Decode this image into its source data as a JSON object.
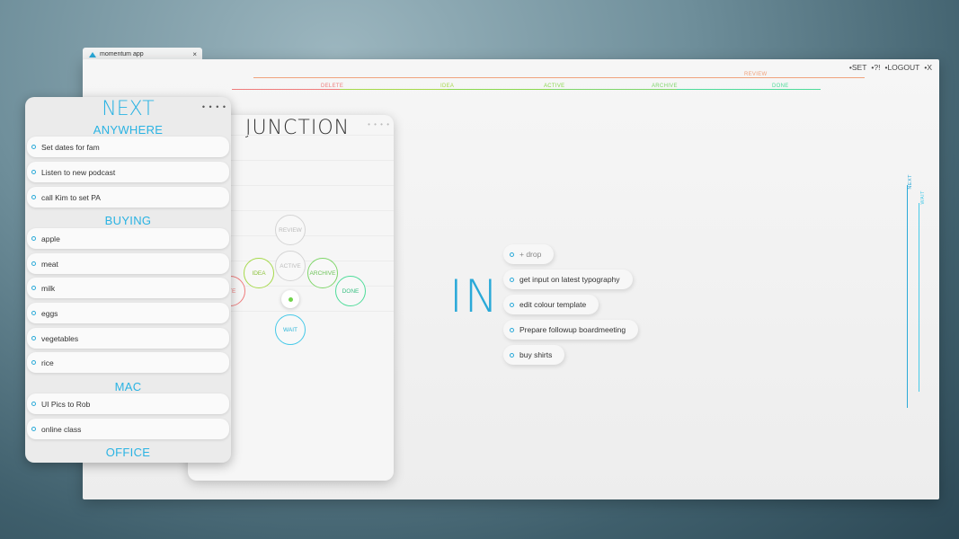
{
  "tab": {
    "title": "momentum app",
    "close": "×"
  },
  "topnav": {
    "set": "•SET",
    "help": "•?!",
    "logout": "•LOGOUT",
    "close": "•X"
  },
  "flow_labels": {
    "review": "REVIEW",
    "delete": "DELETE",
    "idea": "IDEA",
    "active": "ACTIVE",
    "archive": "ARCHIVE",
    "done": "DONE",
    "next": "NEXT",
    "wait": "WAIT"
  },
  "colors": {
    "accent": "#2aa9d8",
    "review": "#f0a27c",
    "delete": "#ef7d7d",
    "idea": "#a6d94b",
    "active": "#8ad84f",
    "archive": "#7fd66a",
    "done": "#4fdc9a",
    "wait": "#46c9e8"
  },
  "junction": {
    "title": "JUNCTION",
    "dots": "• • • •",
    "circles": {
      "review": "REVIEW",
      "active": "ACTIVE",
      "idea": "IDEA",
      "archive": "ARCHIVE",
      "delete": "ETE",
      "done": "DONE",
      "wait": "WAIT"
    }
  },
  "inbox": {
    "title": "IN",
    "items": [
      "+ drop",
      "get input on latest typography",
      "edit colour template",
      "Prepare followup boardmeeting",
      "buy shirts"
    ]
  },
  "next": {
    "title": "NEXT",
    "dots": "• • • •",
    "categories": [
      {
        "name": "ANYWHERE",
        "items": [
          "Set dates for fam",
          "Listen to new podcast",
          "call Kim to set PA"
        ]
      },
      {
        "name": "BUYING",
        "items": [
          "apple",
          "meat",
          "milk",
          "eggs",
          "vegetables",
          "rice"
        ]
      },
      {
        "name": "MAC",
        "items": [
          "UI Pics to Rob",
          "online class"
        ]
      },
      {
        "name": "OFFICE",
        "items": []
      }
    ]
  }
}
